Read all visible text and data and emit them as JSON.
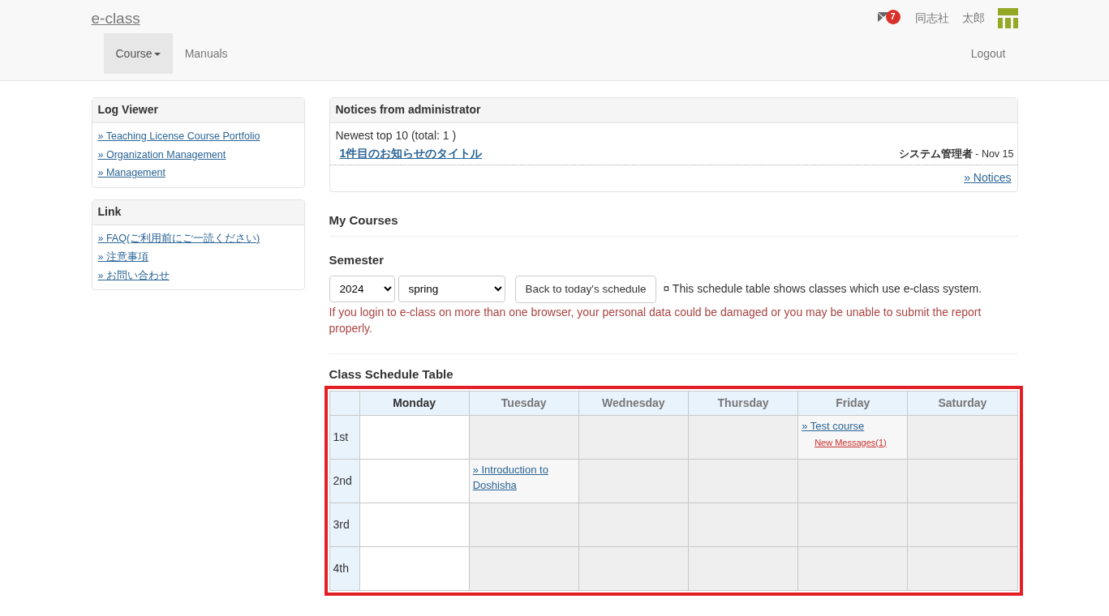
{
  "navbar": {
    "brand": "e-class",
    "menu": [
      {
        "label": "Course",
        "dropdown": true,
        "selected": true
      },
      {
        "label": "Manuals",
        "dropdown": false,
        "selected": false
      }
    ],
    "message_count": "7",
    "user_org": "同志社",
    "user_name": "太郎",
    "logout": "Logout"
  },
  "sidebar": [
    {
      "title": "Log Viewer",
      "links": [
        "» Teaching License Course Portfolio",
        "» Organization Management",
        "» Management"
      ]
    },
    {
      "title": "Link",
      "links": [
        "» FAQ(ご利用前にご一読ください)",
        "» 注意事項",
        "» お問い合わせ"
      ]
    }
  ],
  "notices": {
    "title": "Notices from administrator",
    "summary": "Newest top 10 (total: 1 )",
    "items": [
      {
        "title": "1件目のお知らせのタイトル",
        "author": "システム管理者",
        "date": " - Nov 15"
      }
    ],
    "more_link": "» Notices"
  },
  "my_courses": {
    "title": "My Courses",
    "semester_label": "Semester",
    "year": "2024",
    "term": "spring",
    "back_button": "Back to today's schedule",
    "note": "¤ This schedule table shows classes which use e-class system.",
    "warning": "If you login to e-class on more than one browser, your personal data could be damaged or you may be unable to submit the report properly."
  },
  "schedule": {
    "title": "Class Schedule Table",
    "days": [
      {
        "label": "Monday",
        "selected": true
      },
      {
        "label": "Tuesday",
        "selected": false
      },
      {
        "label": "Wednesday",
        "selected": false
      },
      {
        "label": "Thursday",
        "selected": false
      },
      {
        "label": "Friday",
        "selected": false
      },
      {
        "label": "Saturday",
        "selected": false
      }
    ],
    "periods": [
      {
        "label": "1st",
        "cells": [
          null,
          null,
          null,
          null,
          {
            "course": "» Test course",
            "messages": "New Messages(1)"
          },
          null
        ]
      },
      {
        "label": "2nd",
        "cells": [
          null,
          {
            "course": "» Introduction to Doshisha"
          },
          null,
          null,
          null,
          null
        ]
      },
      {
        "label": "3rd",
        "cells": [
          null,
          null,
          null,
          null,
          null,
          null
        ]
      },
      {
        "label": "4th",
        "cells": [
          null,
          null,
          null,
          null,
          null,
          null
        ]
      }
    ]
  }
}
